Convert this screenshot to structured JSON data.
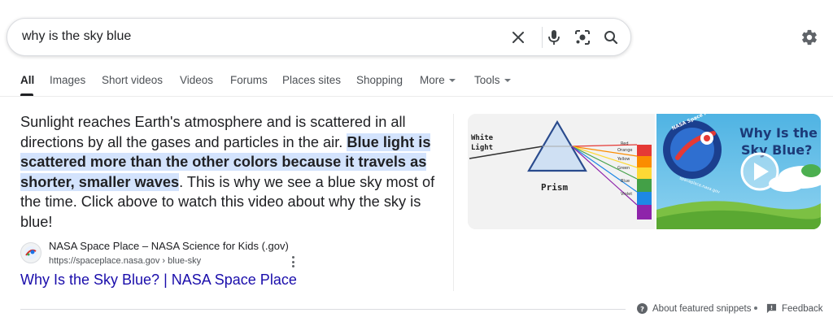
{
  "search": {
    "query": "why is the sky blue"
  },
  "tabs": [
    {
      "label": "All"
    },
    {
      "label": "Images"
    },
    {
      "label": "Short videos"
    },
    {
      "label": "Videos"
    },
    {
      "label": "Forums"
    },
    {
      "label": "Places sites"
    },
    {
      "label": "Shopping"
    },
    {
      "label": "More"
    },
    {
      "label": "Tools"
    }
  ],
  "snippet": {
    "text_before": "Sunlight reaches Earth's atmosphere and is scattered in all directions by all the gases and particles in the air. ",
    "highlight": "Blue light is scattered more than the other colors because it travels as shorter, smaller waves",
    "text_after": ". This is why we see a blue sky most of the time. Click above to watch this video about why the sky is blue!"
  },
  "source": {
    "site_name": "NASA Space Place – NASA Science for Kids (.gov)",
    "url": "https://spaceplace.nasa.gov › blue-sky"
  },
  "result": {
    "title": "Why Is the Sky Blue? | NASA Space Place"
  },
  "images": {
    "prism": {
      "label_white_light_1": "White",
      "label_white_light_2": "Light",
      "label_prism": "Prism",
      "colors": [
        "Red",
        "Orange",
        "Yellow",
        "Green",
        "Blue",
        "Violet"
      ]
    },
    "video": {
      "title_line1": "Why Is the",
      "title_line2": "Sky Blue?",
      "badge_top": "NASA Space Place",
      "badge_bottom": "spaceplace.nasa.gov"
    }
  },
  "footer": {
    "about": "About featured snippets",
    "feedback": "Feedback"
  },
  "colors": {
    "link": "#1a0dab",
    "highlight": "#d3e3fd",
    "text": "#202124"
  }
}
